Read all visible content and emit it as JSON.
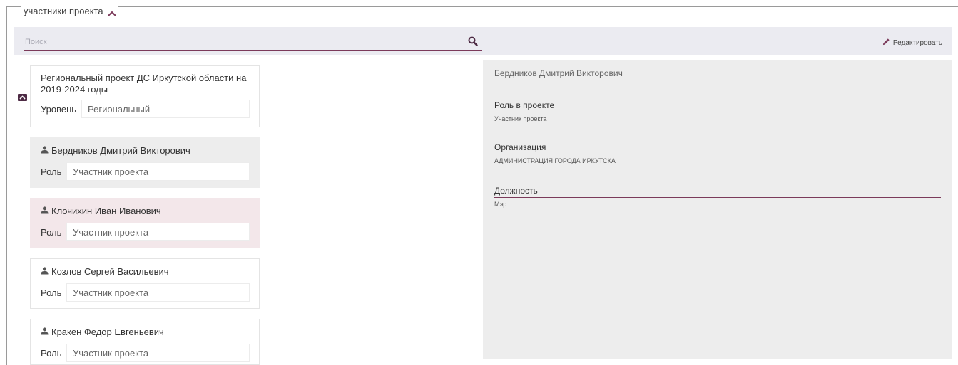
{
  "section": {
    "title": "участники проекта"
  },
  "toolbar": {
    "search_placeholder": "Поиск",
    "edit_label": "Редактировать"
  },
  "project": {
    "title": "Региональный проект ДС Иркутской области на 2019-2024 годы",
    "level_label": "Уровень",
    "level_value": "Региональный"
  },
  "participants": [
    {
      "name": "Бердников Дмитрий Викторович",
      "role_label": "Роль",
      "role_value": "Участник проекта"
    },
    {
      "name": "Клочихин Иван Иванович",
      "role_label": "Роль",
      "role_value": "Участник проекта"
    },
    {
      "name": "Козлов Сергей Васильевич",
      "role_label": "Роль",
      "role_value": "Участник проекта"
    },
    {
      "name": "Кракен Федор Евгеньевич",
      "role_label": "Роль",
      "role_value": "Участник проекта"
    }
  ],
  "detail": {
    "name": "Бердников Дмитрий Викторович",
    "role_label": "Роль в проекте",
    "role_value": "Участник проекта",
    "org_label": "Организация",
    "org_value": "АДМИНИСТРАЦИЯ ГОРОДА ИРКУТСКА",
    "position_label": "Должность",
    "position_value": "Мэр"
  },
  "icons": {
    "section_toggle": "chevron-up-icon",
    "search": "search-icon",
    "edit": "pencil-icon",
    "collapse": "chevron-up-icon",
    "person": "user-icon"
  },
  "colors": {
    "accent": "#7b3a5a",
    "collapse_button": "#4d2a44",
    "selected_card": "#f3e7ea",
    "active_card": "#ededed",
    "toolbar_bg": "#ebebf1",
    "detail_bg": "#ededed"
  }
}
